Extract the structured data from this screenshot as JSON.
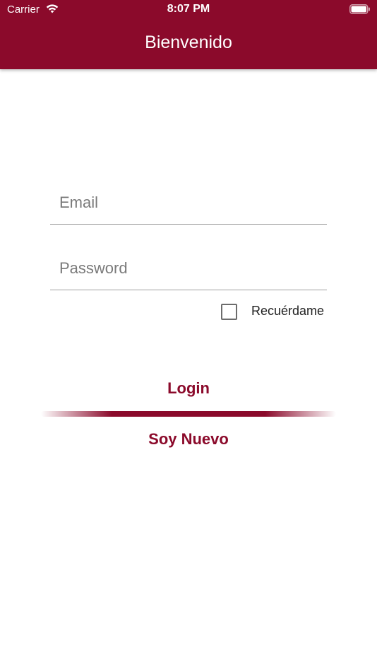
{
  "status_bar": {
    "carrier": "Carrier",
    "time": "8:07 PM"
  },
  "app_bar": {
    "title": "Bienvenido",
    "color": "#8b0a2b"
  },
  "form": {
    "email_placeholder": "Email",
    "email_value": "",
    "password_placeholder": "Password",
    "password_value": "",
    "remember_label": "Recuérdame",
    "remember_checked": false
  },
  "actions": {
    "login_label": "Login",
    "signup_label": "Soy Nuevo"
  },
  "icons": {
    "wifi": "wifi-icon",
    "battery": "battery-icon",
    "checkbox": "checkbox-unchecked"
  }
}
